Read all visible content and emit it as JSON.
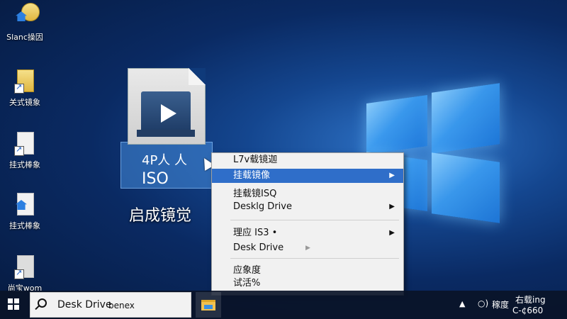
{
  "desktop": {
    "icons": [
      {
        "label": "Slanc操因"
      },
      {
        "label": "关式镜象"
      },
      {
        "label": "挂式棒象"
      },
      {
        "label": "挂式棒象"
      },
      {
        "label": "尚宝​wom"
      }
    ],
    "iso_file": {
      "name_line1": "4P人 人",
      "name_line2": "ISO",
      "caption": "启成镜觉"
    }
  },
  "context_menu": {
    "items": [
      {
        "label": "L7v载镜迦"
      },
      {
        "label": "挂载镜像",
        "arrow": "▶"
      },
      {
        "label": "挂载镜ISQ",
        "sub": "Desklg Drive",
        "arrow": "▶"
      },
      {
        "label": "理应 IS3 •",
        "arrow": "▶"
      },
      {
        "label": "Desk Drive",
        "arrow": "▶"
      },
      {
        "label": "应象度"
      },
      {
        "label": "试活%"
      }
    ]
  },
  "taskbar": {
    "search_text": "Desk Drive",
    "search_extra": "benex",
    "tray_chevron": "▲",
    "tray_icon": "○)",
    "tray_text": "稼度",
    "clock_line1": "右载ing",
    "clock_line2": "C-¢660"
  },
  "colors": {
    "menu_highlight": "#2f6ec9",
    "desktop_bg": "#0a2a63",
    "taskbar": "#0a1428"
  }
}
